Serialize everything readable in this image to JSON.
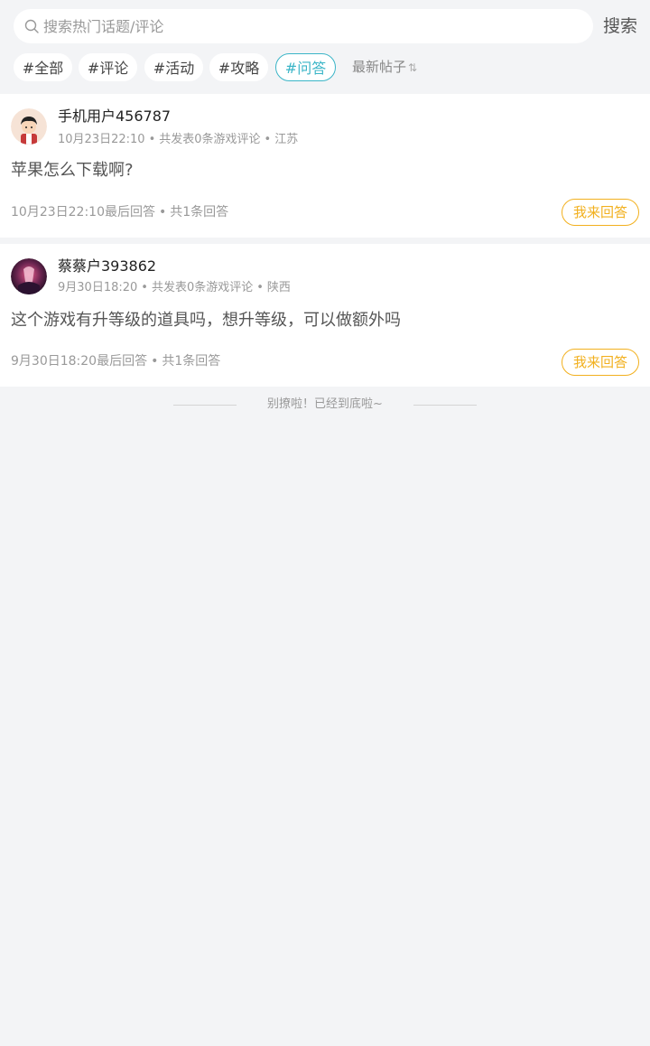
{
  "search": {
    "placeholder": "搜索热门话题/评论",
    "button_label": "搜索",
    "icon": "search-icon"
  },
  "tags": [
    {
      "label": "#全部",
      "active": false
    },
    {
      "label": "#评论",
      "active": false
    },
    {
      "label": "#活动",
      "active": false
    },
    {
      "label": "#攻略",
      "active": false
    },
    {
      "label": "#问答",
      "active": true
    }
  ],
  "sort": {
    "label": "最新帖子",
    "icon": "⇅"
  },
  "posts": [
    {
      "username": "手机用户456787",
      "time": "10月23日22:10",
      "stats": "共发表0条游戏评论",
      "location": "江苏",
      "content": "苹果怎么下载啊?",
      "last_reply": "10月23日22:10最后回答",
      "reply_count": "共1条回答",
      "answer_label": "我来回答"
    },
    {
      "username": "蔡蔡户393862",
      "time": "9月30日18:20",
      "stats": "共发表0条游戏评论",
      "location": "陕西",
      "content": "这个游戏有升等级的道具吗，想升等级，可以做额外吗",
      "last_reply": "9月30日18:20最后回答",
      "reply_count": "共1条回答",
      "answer_label": "我来回答"
    }
  ],
  "end_text": "别撩啦！已经到底啦~",
  "colors": {
    "accent_active": "#3bb5c7",
    "answer_button": "#f2b01e",
    "background": "#f3f4f6"
  }
}
